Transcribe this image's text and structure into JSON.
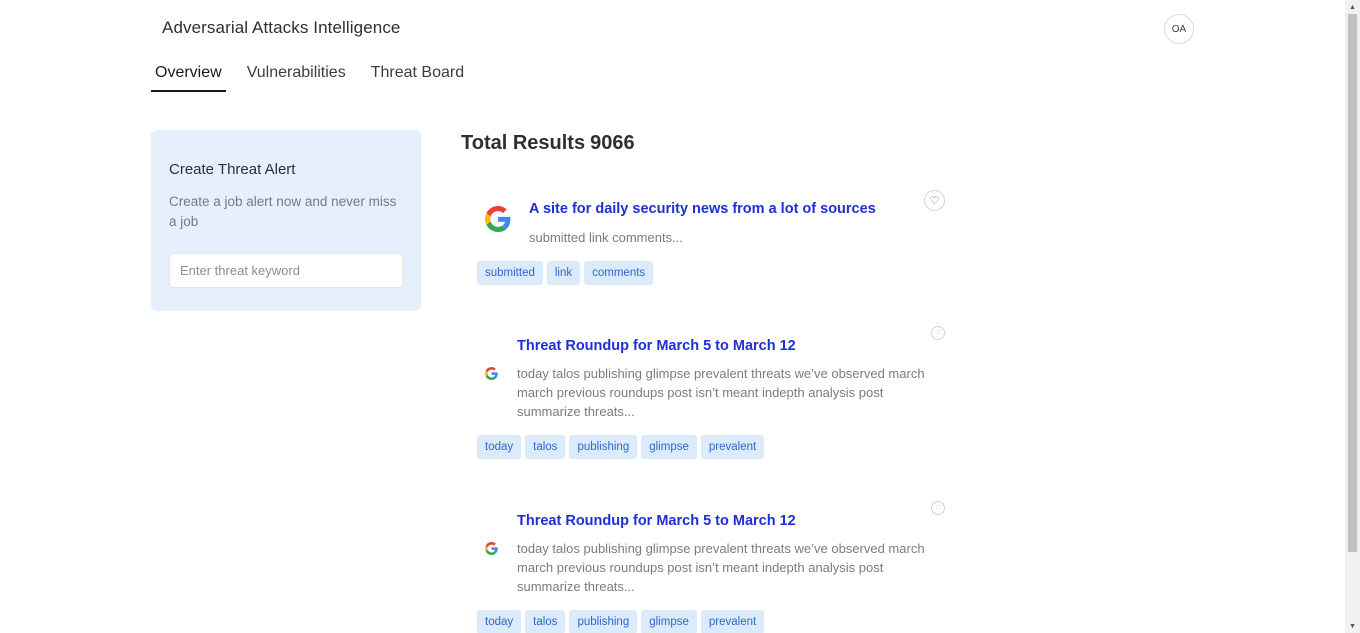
{
  "header": {
    "app_title": "Adversarial Attacks Intelligence",
    "avatar_initials": "OA"
  },
  "tabs": [
    {
      "label": "Overview",
      "active": true
    },
    {
      "label": "Vulnerabilities",
      "active": false
    },
    {
      "label": "Threat Board",
      "active": false
    }
  ],
  "alert": {
    "title": "Create Threat Alert",
    "description": "Create a job alert now and never miss a job",
    "input_placeholder": "Enter threat keyword",
    "input_value": ""
  },
  "results": {
    "total_label": "Total Results",
    "total_count": "9066",
    "items": [
      {
        "logo": "google-logo",
        "title": "A site for daily security news from a lot of sources",
        "description": "submitted link comments...",
        "tags": [
          "submitted",
          "link",
          "comments"
        ]
      },
      {
        "logo": "google-logo",
        "title": "Threat Roundup for March 5 to March 12",
        "description": "today talos publishing glimpse prevalent threats we’ve observed march march previous roundups post isn’t meant indepth analysis post summarize threats...",
        "tags": [
          "today",
          "talos",
          "publishing",
          "glimpse",
          "prevalent"
        ]
      },
      {
        "logo": "google-logo",
        "title": "Threat Roundup for March 5 to March 12",
        "description": "today talos publishing glimpse prevalent threats we’ve observed march march previous roundups post isn’t meant indepth analysis post summarize threats...",
        "tags": [
          "today",
          "talos",
          "publishing",
          "glimpse",
          "prevalent"
        ]
      }
    ]
  },
  "icons": {
    "favorite": "heart-icon",
    "avatar": "user-avatar"
  },
  "colors": {
    "accent_link": "#1f2fd6",
    "tag_bg": "#dcebfb",
    "tag_text": "#2f66c9",
    "alert_card_bg": "#e5f0fc"
  }
}
